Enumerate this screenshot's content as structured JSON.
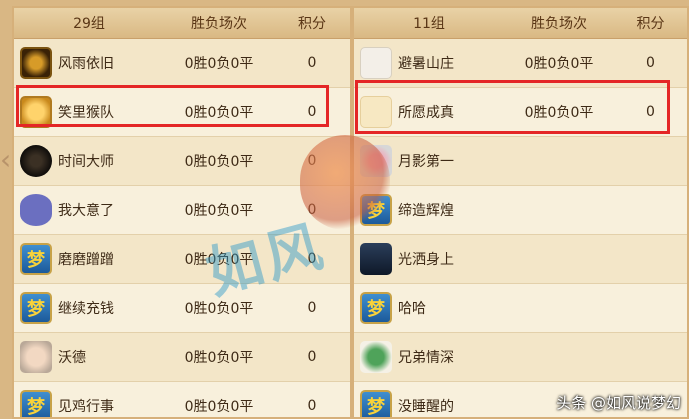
{
  "left_panel": {
    "headers": [
      "29组",
      "胜负场次",
      "积分"
    ],
    "rows": [
      {
        "name": "风雨依旧",
        "record": "0胜0负0平",
        "points": "0",
        "avatar": "dragon-emblem-icon"
      },
      {
        "name": "笑里猴队",
        "record": "0胜0负0平",
        "points": "0",
        "avatar": "monkey-face-icon"
      },
      {
        "name": "时间大师",
        "record": "0胜0负0平",
        "points": "0",
        "avatar": "dark-orb-icon"
      },
      {
        "name": "我大意了",
        "record": "0胜0负0平",
        "points": "0",
        "avatar": "purple-blob-icon"
      },
      {
        "name": "磨磨蹭蹭",
        "record": "0胜0负0平",
        "points": "0",
        "avatar": "meng-badge-icon"
      },
      {
        "name": "继续充钱",
        "record": "0胜0负0平",
        "points": "0",
        "avatar": "meng-badge-icon"
      },
      {
        "name": "沃德",
        "record": "0胜0负0平",
        "points": "0",
        "avatar": "child-photo-icon"
      },
      {
        "name": "见鸡行事",
        "record": "0胜0负0平",
        "points": "0",
        "avatar": "meng-badge-icon"
      }
    ]
  },
  "right_panel": {
    "headers": [
      "11组",
      "胜负场次",
      "积分"
    ],
    "rows": [
      {
        "name": "避暑山庄",
        "record": "0胜0负0平",
        "points": "0",
        "avatar": "logo-icon"
      },
      {
        "name": "所愿成真",
        "record": "0胜0负0平",
        "points": "0",
        "avatar": "blank-avatar-icon"
      },
      {
        "name": "月影第一",
        "record": "",
        "points": "",
        "avatar": "spider-icon"
      },
      {
        "name": "缔造辉煌",
        "record": "",
        "points": "",
        "avatar": "meng-badge-icon"
      },
      {
        "name": "光洒身上",
        "record": "",
        "points": "",
        "avatar": "night-scene-icon"
      },
      {
        "name": "哈哈",
        "record": "",
        "points": "",
        "avatar": "meng-badge-icon"
      },
      {
        "name": "兄弟情深",
        "record": "",
        "points": "",
        "avatar": "green-creature-icon"
      },
      {
        "name": "没睡醒的",
        "record": "",
        "points": "",
        "avatar": "meng-badge-icon"
      }
    ]
  },
  "avatar_glyph": "梦",
  "credit": "头条 @如风说梦幻",
  "highlight_color": "#e42626"
}
